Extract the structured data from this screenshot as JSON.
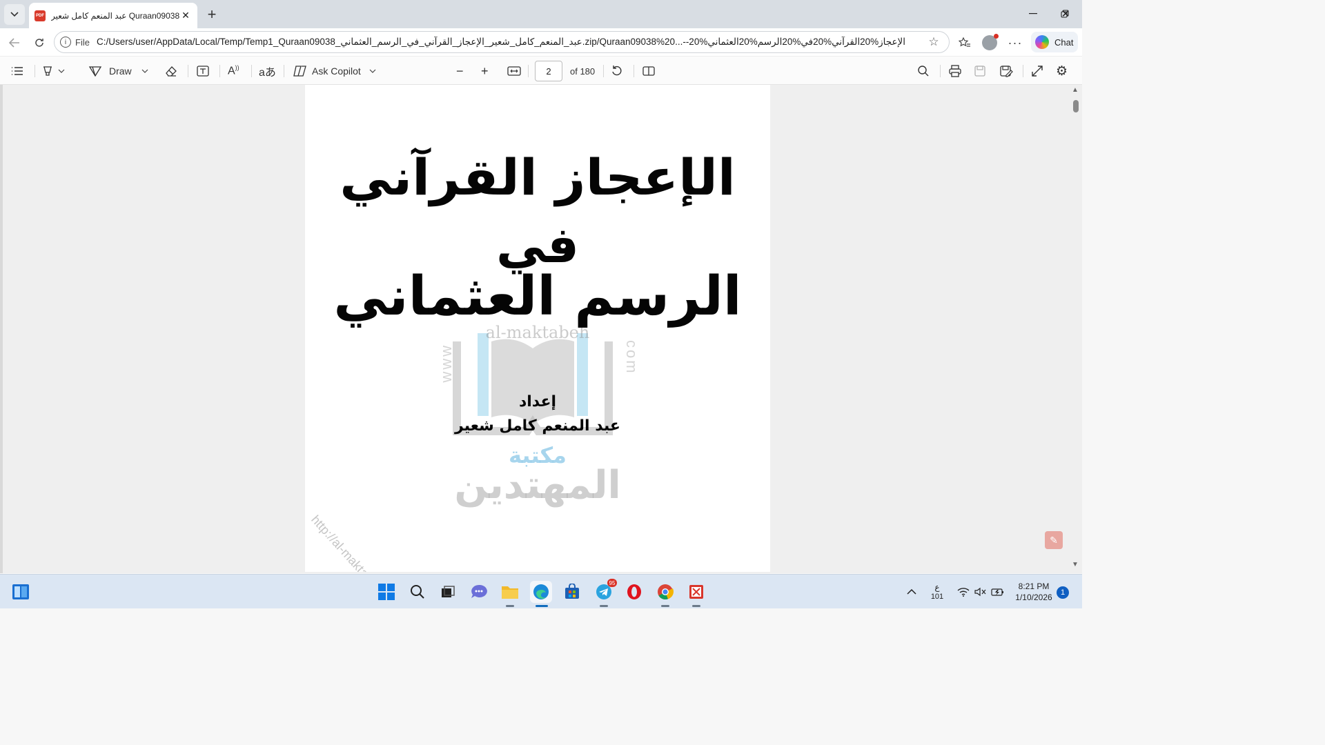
{
  "browser": {
    "tab": {
      "title": "عبد المنعم كامل شعير Quraan09038",
      "favicon_label": "PDF"
    },
    "address": {
      "scheme_label": "File",
      "url": "C:/Users/user/AppData/Local/Temp/Temp1_Quraan09038_عبد_المنعم_كامل_شعير_الإعجاز_القرآني_في_الرسم_العثماني.zip/Quraan09038%20...--20%الإعجاز%20القرآني%20في%20الرسم%20العثماني"
    },
    "chat_label": "Chat"
  },
  "pdf_toolbar": {
    "draw_label": "Draw",
    "ask_copilot_label": "Ask Copilot",
    "page_current": "2",
    "page_total_label": "of 180"
  },
  "document": {
    "title_line1": "الإعجاز القرآني",
    "title_line2": "في",
    "title_line3": "الرسم العثماني",
    "prepared_by_label": "إعداد",
    "author": "عبد المنعم كامل شعير",
    "watermark": {
      "top_text": "al-maktabeh",
      "left_text": "www",
      "right_text": "com",
      "library_word": "مكتبة",
      "library_name": "المهتدين",
      "url": "http://al-maktabeh.com"
    }
  },
  "taskbar": {
    "telegram_badge": "95",
    "tray_lang": "ع",
    "tray_lang_sub": "101",
    "time": "8:21 PM",
    "date": "1/10/2026",
    "notification_count": "1"
  },
  "colors": {
    "tab_strip": "#d8dde3",
    "toolbar": "#fbfbfb",
    "taskbar": "#dbe6f3",
    "pdf_favicon": "#d93a2b",
    "watermark_blue": "#82c3e6"
  }
}
